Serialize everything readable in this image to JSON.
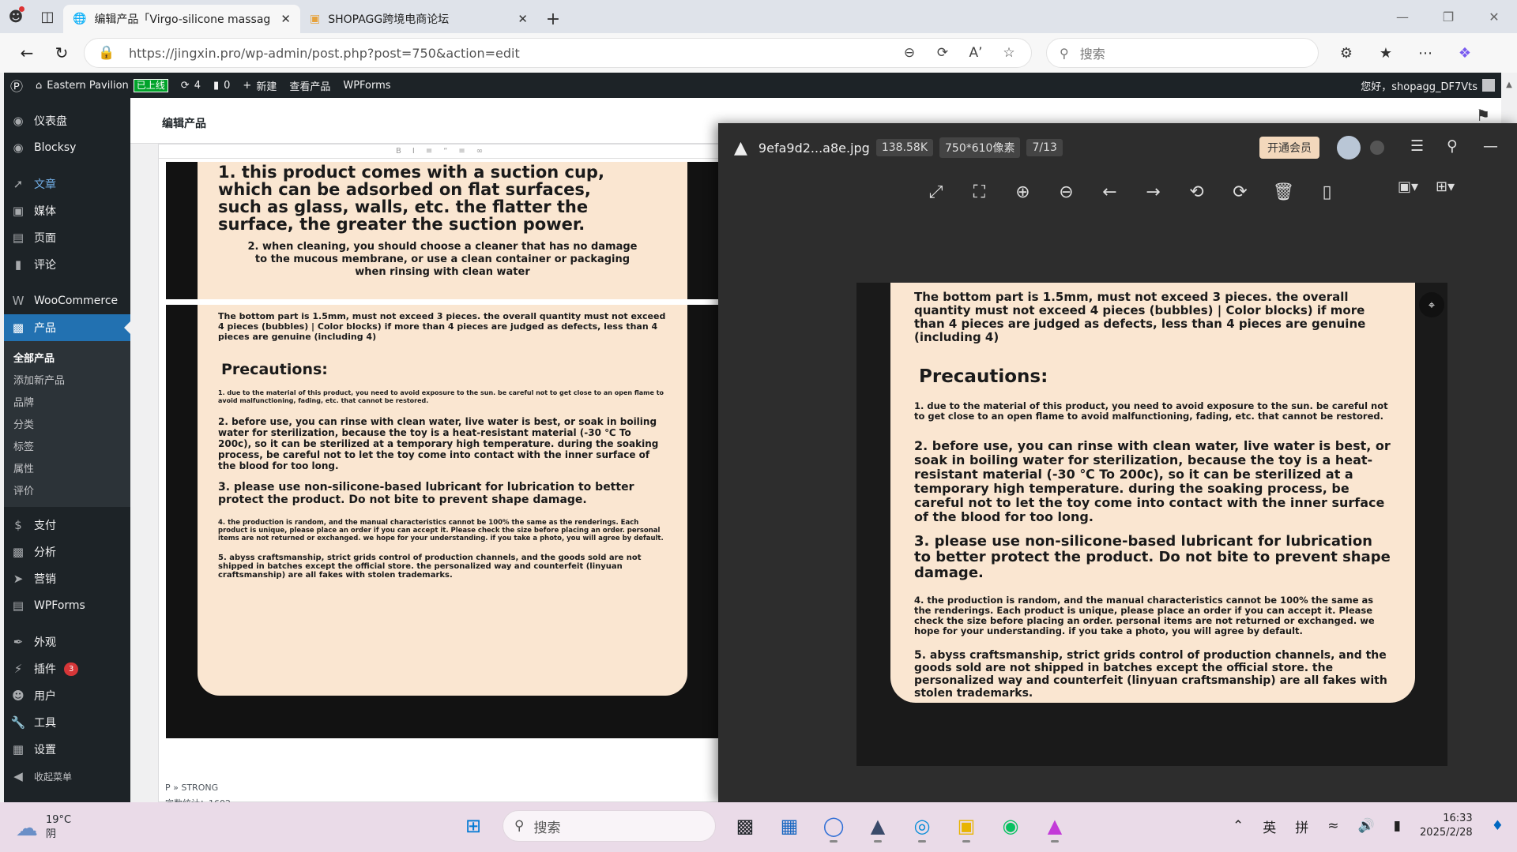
{
  "browser": {
    "tabs": [
      {
        "title": "编辑产品「Virgo-silicone massag",
        "active": true
      },
      {
        "title": "SHOPAGG跨境电商论坛",
        "active": false
      }
    ],
    "url": "https://jingxin.pro/wp-admin/post.php?post=750&action=edit",
    "search_placeholder": "搜索"
  },
  "wp_adminbar": {
    "site": "Eastern Pavilion",
    "live_badge": "已上线",
    "updates": "4",
    "comments": "0",
    "new": "新建",
    "view_product": "查看产品",
    "wpforms": "WPForms",
    "greeting": "您好，shopagg_DF7Vts"
  },
  "sidebar": {
    "items": [
      {
        "label": "仪表盘",
        "icon": "dashboard-icon"
      },
      {
        "label": "Blocksy",
        "icon": "blocksy-icon"
      },
      {
        "label": "文章",
        "icon": "pin-icon"
      },
      {
        "label": "媒体",
        "icon": "media-icon"
      },
      {
        "label": "页面",
        "icon": "page-icon"
      },
      {
        "label": "评论",
        "icon": "comment-icon"
      },
      {
        "label": "WooCommerce",
        "icon": "woo-icon"
      },
      {
        "label": "产品",
        "icon": "product-icon"
      }
    ],
    "product_sub": [
      "全部产品",
      "添加新产品",
      "品牌",
      "分类",
      "标签",
      "属性",
      "评价"
    ],
    "items2": [
      {
        "label": "支付",
        "icon": "payment-icon"
      },
      {
        "label": "分析",
        "icon": "analytics-icon"
      },
      {
        "label": "营销",
        "icon": "marketing-icon"
      },
      {
        "label": "WPForms",
        "icon": "wpforms-icon"
      },
      {
        "label": "外观",
        "icon": "appearance-icon"
      },
      {
        "label": "插件",
        "icon": "plugin-icon",
        "badge": "3"
      },
      {
        "label": "用户",
        "icon": "user-icon"
      },
      {
        "label": "工具",
        "icon": "tools-icon"
      },
      {
        "label": "设置",
        "icon": "settings-icon"
      },
      {
        "label": "收起菜单",
        "icon": "collapse-icon"
      }
    ]
  },
  "page": {
    "title": "编辑产品",
    "editor_status": "P » STRONG",
    "word_count": "字数统计：1602"
  },
  "card_top": {
    "l1": "1. this product comes with a suction cup,",
    "l2": "which can be adsorbed on flat surfaces,",
    "l3": "such as glass, walls, etc. the flatter the",
    "l4": "surface, the greater the suction power.",
    "l5": "2. when cleaning, you should choose a cleaner that has no damage",
    "l6": "to the mucous membrane, or use a clean container or packaging",
    "l7": "when rinsing with clean water"
  },
  "card": {
    "intro": "The bottom part is 1.5mm, must not exceed 3 pieces. the overall quantity must not exceed 4 pieces (bubbles) | Color blocks) if more than 4 pieces are judged as defects, less than 4 pieces are genuine (including 4)",
    "heading": "Precautions:",
    "p1": "1. due to the material of this product, you need to avoid exposure to the sun. be careful not to get close to an open flame to avoid malfunctioning, fading, etc. that cannot be restored.",
    "p2": "2. before use, you can rinse with clean water, live water is best, or soak in boiling water for sterilization, because the toy is a heat-resistant material (-30 ℃ To 200c), so it can be sterilized at a temporary high temperature. during the soaking process, be careful not to let the toy come into contact with the inner surface of the blood for too long.",
    "p3": "3. please use non-silicone-based lubricant for lubrication to better protect the product. Do not bite to prevent shape damage.",
    "p4": "4. the production is random, and the manual characteristics cannot be 100% the same as the renderings. Each product is unique, please place an order if you can accept it. Please check the size before placing an order. personal items are not returned or exchanged. we hope for your understanding. if you take a photo, you will agree by default.",
    "p5": "5. abyss craftsmanship, strict grids control of production channels, and the goods sold are not shipped in batches except the official store. the personalized way and counterfeit (linyuan craftsmanship) are all fakes with stolen trademarks."
  },
  "viewer": {
    "filename": "9efa9d2...a8e.jpg",
    "filesize": "138.58K",
    "dimensions": "750*610像素",
    "index": "7/13",
    "vip": "开通会员"
  },
  "taskbar": {
    "temp": "19°C",
    "weather": "阴",
    "search": "搜索",
    "ime1": "英",
    "ime2": "拼",
    "time": "16:33",
    "date": "2025/2/28"
  }
}
